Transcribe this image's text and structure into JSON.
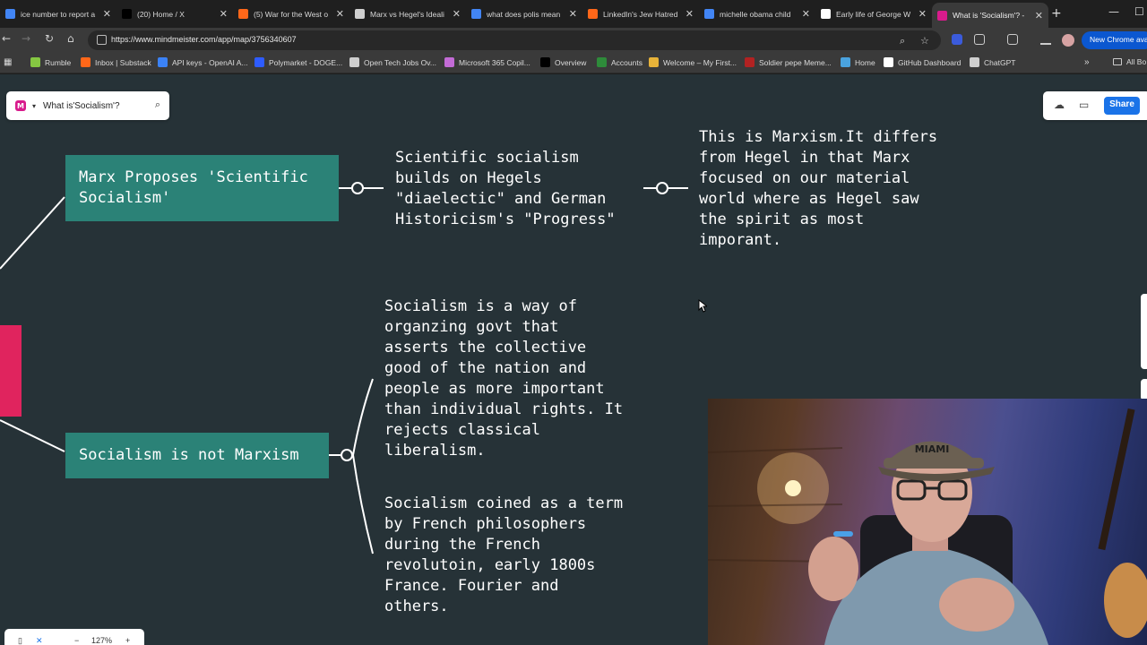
{
  "browser": {
    "tabs": [
      {
        "title": "ice number to report a",
        "icon": "google-icon",
        "color": "#4285f4"
      },
      {
        "title": "(20) Home / X",
        "icon": "x-icon",
        "color": "#000000"
      },
      {
        "title": "(5) War for the West o",
        "icon": "substack-icon",
        "color": "#ff6719"
      },
      {
        "title": "Marx vs Hegel's Ideali",
        "icon": "chatgpt-icon",
        "color": "#cfcfcf"
      },
      {
        "title": "what does polis mean",
        "icon": "google-icon",
        "color": "#4285f4"
      },
      {
        "title": "LinkedIn's Jew Hatred",
        "icon": "substack-icon",
        "color": "#ff6719"
      },
      {
        "title": "michelle obama child",
        "icon": "google-icon",
        "color": "#4285f4"
      },
      {
        "title": "Early life of George W",
        "icon": "wikipedia-icon",
        "color": "#ffffff"
      },
      {
        "title": "What is 'Socialism'? -",
        "icon": "mindmeister-icon",
        "color": "#d81b8c"
      }
    ],
    "url": "https://www.mindmeister.com/app/map/3756340607",
    "new_chrome_label": "New Chrome avai",
    "bookmarks": [
      {
        "label": "Rumble",
        "icon": "rumble-icon",
        "color": "#85c742"
      },
      {
        "label": "Inbox | Substack",
        "icon": "substack-icon",
        "color": "#ff6719"
      },
      {
        "label": "API keys - OpenAI A...",
        "icon": "openai-icon",
        "color": "#3b82f6"
      },
      {
        "label": "Polymarket - DOGE...",
        "icon": "polymarket-icon",
        "color": "#2e5cff"
      },
      {
        "label": "Open Tech Jobs Ov...",
        "icon": "pin-icon",
        "color": "#cfcfcf"
      },
      {
        "label": "Microsoft 365 Copil...",
        "icon": "copilot-icon",
        "color": "#c36bd6"
      },
      {
        "label": "Overview",
        "icon": "x-icon",
        "color": "#000000"
      },
      {
        "label": "Accounts",
        "icon": "td-icon",
        "color": "#2e8b3a"
      },
      {
        "label": "Welcome – My First...",
        "icon": "chrome-icon",
        "color": "#e8b339"
      },
      {
        "label": "Soldier pepe Meme...",
        "icon": "meme-icon",
        "color": "#b22222"
      },
      {
        "label": "Home",
        "icon": "cloud-icon",
        "color": "#4aa3df"
      },
      {
        "label": "GitHub Dashboard",
        "icon": "github-icon",
        "color": "#ffffff"
      },
      {
        "label": "ChatGPT",
        "icon": "chatgpt-icon",
        "color": "#cfcfcf"
      }
    ],
    "all_bookmarks_label": "All Bo"
  },
  "mindmap": {
    "map_title": "What is'Socialism'?",
    "share_label": "Share",
    "zoom_level": "127%",
    "nodes": {
      "marx_proposes": "Marx Proposes 'Scientific\nSocialism'",
      "scientific_socialism": "Scientific socialism\nbuilds on Hegels\n\"diaelectic\" and German\nHistoricism's \"Progress\"",
      "this_is_marxism": "This is Marxism.It differs\nfrom Hegel in that Marx\nfocused on our material\nworld where as Hegel saw\nthe spirit as most\nimporant.",
      "socialism_not_marxism": "Socialism is not Marxism",
      "socialism_definition": "Socialism is a way of\norganzing govt that\nasserts the collective\ngood of the nation and\npeople as more important\nthan individual rights. It\nrejects classical\nliberalism.",
      "socialism_coined": "Socialism coined as a term\nby French philosophers\nduring the French\nrevolutoin, early 1800s\nFrance. Fourier and\nothers."
    },
    "colors": {
      "canvas": "#263237",
      "topic_node": "#2b8277",
      "root_node": "#e0245e",
      "connector": "#ffffff"
    }
  },
  "webcam": {
    "hat_text": "MIAMI"
  }
}
